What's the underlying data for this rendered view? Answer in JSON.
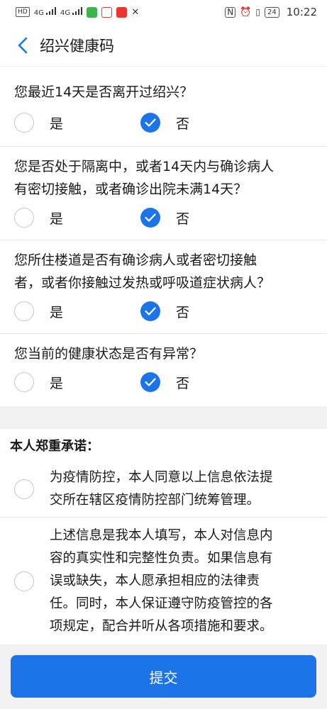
{
  "status_bar": {
    "network_badge": "HD",
    "signal_1": "4G",
    "signal_2": "4G",
    "battery": "24",
    "time": "10:22",
    "accent_primary": "#1c74e8"
  },
  "nav": {
    "title": "绍兴健康码",
    "back_icon": "chevron-left-icon"
  },
  "questions": [
    {
      "text_lines": [
        "您最近14天是否离开过绍兴？"
      ],
      "yes_label": "是",
      "no_label": "否",
      "selected": "no"
    },
    {
      "text_lines": [
        "您是否处于隔离中，或者14天内与确诊病人",
        "有密切接触，或者确诊出院未满14天？"
      ],
      "yes_label": "是",
      "no_label": "否",
      "selected": "no"
    },
    {
      "text_lines": [
        "您所住楼道是否有确诊病人或者密切接触",
        "者，或者你接触过发热或呼吸道症状病人？"
      ],
      "yes_label": "是",
      "no_label": "否",
      "selected": "no"
    },
    {
      "text_lines": [
        "您当前的健康状态是否有异常？"
      ],
      "yes_label": "是",
      "no_label": "否",
      "selected": "no"
    }
  ],
  "pledge": {
    "title": "本人郑重承诺：",
    "items": [
      {
        "text_lines": [
          "为疫情防控，本人同意以上信息依法提",
          "交所在辖区疫情防控部门统筹管理。"
        ],
        "checked": false
      },
      {
        "text_lines": [
          "上述信息是我本人填写，本人对信息内",
          "容的真实性和完整性负责。如果信息有",
          "误或缺失，本人愿承担相应的法律责",
          "任。同时，本人保证遵守防疫管控的各",
          "项规定，配合并听从各项措施和要求。"
        ],
        "checked": false
      }
    ]
  },
  "submit": {
    "label": "提交"
  }
}
